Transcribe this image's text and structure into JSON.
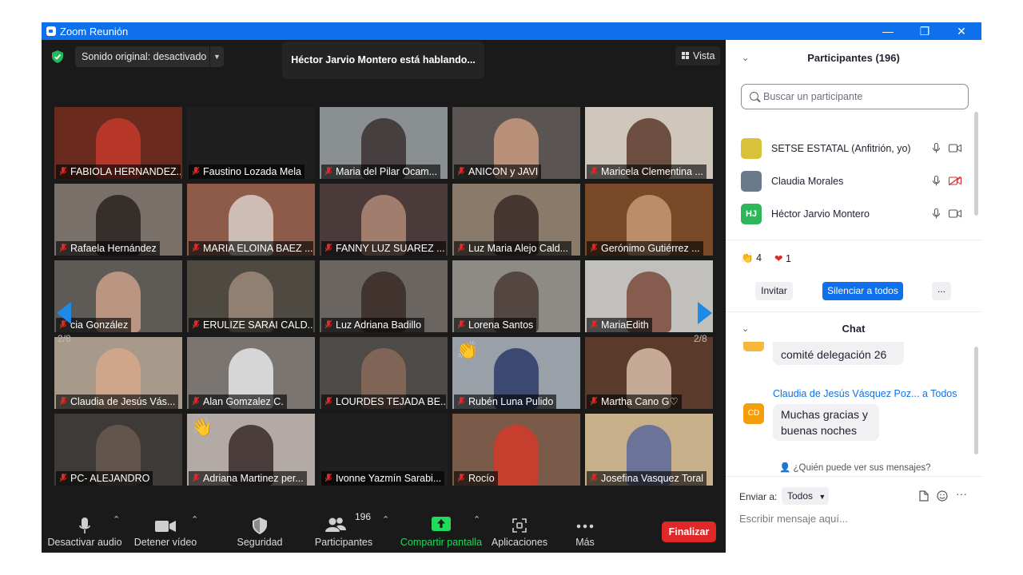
{
  "window": {
    "title": "Zoom Reunión",
    "minimize": "—",
    "restore": "❐",
    "close": "✕"
  },
  "top": {
    "original_sound": "Sonido original: desactivado",
    "speaking": "Héctor Jarvio Montero está hablando...",
    "view_label": "Vista"
  },
  "pager": {
    "left": "2/8",
    "right": "2/8"
  },
  "tiles": [
    {
      "name": "FABIOLA HERNANDEZ...",
      "bg": "#6b2a1e",
      "fg": "#c43a2a"
    },
    {
      "name": "Faustino Lozada Mela",
      "bg": "#1f1f1f",
      "fg": "#1f1f1f"
    },
    {
      "name": "Maria del Pilar Ocam...",
      "bg": "#8a8f92",
      "fg": "#3a3030"
    },
    {
      "name": "ANICON y JAVI",
      "bg": "#5a5552",
      "fg": "#c99a7e"
    },
    {
      "name": "Maricela Clementina ...",
      "bg": "#cfc7bc",
      "fg": "#5a3a2a"
    },
    {
      "name": "Rafaela Hernández",
      "bg": "#7a706a",
      "fg": "#2a2220"
    },
    {
      "name": "MARIA ELOINA BAEZ ...",
      "bg": "#8e5a4a",
      "fg": "#d8cfc8"
    },
    {
      "name": "FANNY LUZ SUAREZ ...",
      "bg": "#4a3a3a",
      "fg": "#b08a78"
    },
    {
      "name": "Luz Maria Alejo Cald...",
      "bg": "#8a7a6a",
      "fg": "#3a2a28"
    },
    {
      "name": "Gerónimo Gutiérrez ...",
      "bg": "#7a4a28",
      "fg": "#c89a72"
    },
    {
      "name": "cia González",
      "bg": "#5e5a55",
      "fg": "#caa08a"
    },
    {
      "name": "ERULIZE SARAI CALD...",
      "bg": "#4e4a42",
      "fg": "#9e8a7a"
    },
    {
      "name": "Luz Adriana Badillo",
      "bg": "#6a6560",
      "fg": "#3a2a24"
    },
    {
      "name": "Lorena Santos",
      "bg": "#8e8a86",
      "fg": "#4a3a34"
    },
    {
      "name": "MariaEdith",
      "bg": "#c2c0bd",
      "fg": "#7a4a3a"
    },
    {
      "name": "Claudia de Jesús Vás...",
      "bg": "#a89a8a",
      "fg": "#d6a888"
    },
    {
      "name": "Alan Gomzalez C.",
      "bg": "#7a7570",
      "fg": "#e8e8e8"
    },
    {
      "name": "LOURDES TEJADA BE...",
      "bg": "#4e4a48",
      "fg": "#8a6a5a"
    },
    {
      "name": "Rubén Luna Pulido",
      "bg": "#9aa0a8",
      "fg": "#2a3a6a"
    },
    {
      "name": "Martha Cano G♡",
      "bg": "#5a3a2a",
      "fg": "#d8c0a8"
    },
    {
      "name": "PC- ALEJANDRO",
      "bg": "#3e3a38",
      "fg": "#6a5a50"
    },
    {
      "name": "Adriana Martinez per...",
      "bg": "#b4aaa5",
      "fg": "#3a2a2a"
    },
    {
      "name": "Ivonne Yazmín Sarabi...",
      "bg": "#1f1f1f",
      "fg": "#1f1f1f"
    },
    {
      "name": "Rocío",
      "bg": "#7a5a48",
      "fg": "#d43a2a"
    },
    {
      "name": "Josefina Vasquez Toral",
      "bg": "#c8b08a",
      "fg": "#5a6a9a"
    }
  ],
  "toolbar": {
    "mute": "Desactivar audio",
    "video": "Detener vídeo",
    "security": "Seguridad",
    "participants": "Participantes",
    "participants_count": "196",
    "share": "Compartir pantalla",
    "apps": "Aplicaciones",
    "more": "Más",
    "end": "Finalizar"
  },
  "panel": {
    "participants_title": "Participantes (196)",
    "search_placeholder": "Buscar un participante",
    "participants": [
      {
        "name": "SETSE ESTATAL (Anfitrión, yo)",
        "avatar": "",
        "avatar_color": "#d8c23a",
        "cam_muted": false
      },
      {
        "name": "Claudia Morales",
        "avatar": "",
        "avatar_color": "#6a7a8a",
        "cam_muted": true
      },
      {
        "name": "Héctor Jarvio Montero",
        "avatar": "HJ",
        "avatar_color": "#2fb55a",
        "cam_muted": false
      }
    ],
    "reactions": {
      "clap_count": "4",
      "heart_count": "1"
    },
    "invite": "Invitar",
    "mute_all": "Silenciar a todos",
    "more": "...",
    "chat_title": "Chat",
    "prev_message_line": "comité delegación 26",
    "sender": "Claudia de Jesús Vásquez Poz...",
    "sender_to": "a Todos",
    "sender_avatar": "CD",
    "message": "Muchas gracias y buenas noches",
    "who_can_see": "¿Quién puede ver sus mensajes?",
    "send_to_label": "Enviar a:",
    "send_to_value": "Todos",
    "compose_placeholder": "Escribir mensaje aquí..."
  },
  "colors": {
    "zoom_blue": "#0e71eb",
    "end_red": "#e02828",
    "share_green": "#23d959"
  }
}
